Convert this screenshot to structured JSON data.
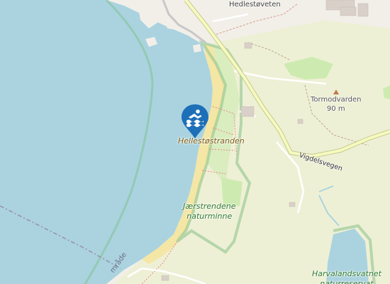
{
  "map": {
    "colors": {
      "water": "#aad3df",
      "land": "#f2efe9",
      "farmland": "#eef0d5",
      "grass": "#cdebb0",
      "sand": "#f4e6a5",
      "protected_border": "#8fc58f",
      "road": "#f7fabf",
      "road_casing": "#c5ca91",
      "pin": "#1d6fb8"
    },
    "labels": {
      "beach": "Hellestøstranden",
      "village": "Hedlestøveten",
      "peak_name": "Tormodvarden",
      "peak_elevation": "90 m",
      "road": "Vigdelsvegen",
      "reserve_line1": "Jærstrendene",
      "reserve_line2": "naturminne",
      "lake_line1": "Harvalandsvatnet",
      "lake_line2": "naturreservat",
      "border_fragment": "mråde"
    },
    "markers": [
      {
        "icon": "swimming-icon",
        "label": "Hellestøstranden"
      }
    ]
  }
}
